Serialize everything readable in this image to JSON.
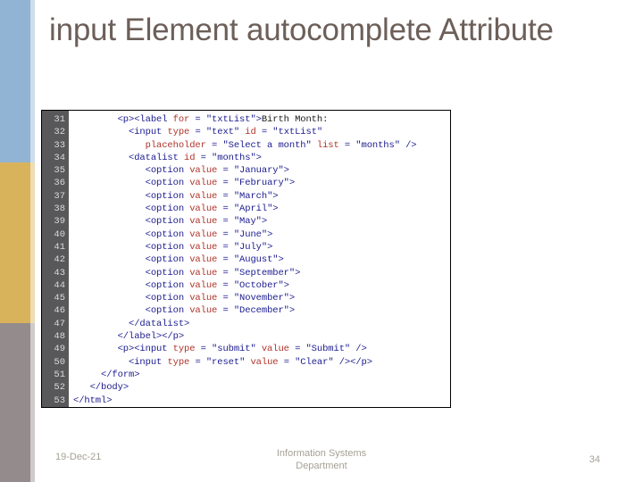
{
  "slide": {
    "title": "input Element autocomplete Attribute",
    "background_color": "#ffffff",
    "title_color": "#6d5f59"
  },
  "sidebar": {
    "bands": [
      {
        "name": "blue-band",
        "color": "#92b4d4"
      },
      {
        "name": "gold-band",
        "color": "#d9b35c"
      },
      {
        "name": "gray-band",
        "color": "#948c8c"
      }
    ]
  },
  "code_block": {
    "gutter_color": "#58585a",
    "line_number_color": "#d9d9d9",
    "border_color": "#000000",
    "tag_color": "#1b1b90",
    "attr_color": "#b0342a",
    "string_color": "#1b1b90",
    "first_line_number": 31,
    "line_numbers": [
      31,
      32,
      33,
      34,
      35,
      36,
      37,
      38,
      39,
      40,
      41,
      42,
      43,
      44,
      45,
      46,
      47,
      48,
      49,
      50,
      51,
      52,
      53
    ],
    "lines": [
      {
        "n": 31,
        "indent": 8,
        "tokens": [
          {
            "t": "tag",
            "v": "<p><label "
          },
          {
            "t": "attr",
            "v": "for"
          },
          {
            "t": "tag",
            "v": " = "
          },
          {
            "t": "str",
            "v": "\"txtList\""
          },
          {
            "t": "tag",
            "v": ">"
          },
          {
            "t": "txt",
            "v": "Birth Month:"
          }
        ]
      },
      {
        "n": 32,
        "indent": 10,
        "tokens": [
          {
            "t": "tag",
            "v": "<input "
          },
          {
            "t": "attr",
            "v": "type"
          },
          {
            "t": "tag",
            "v": " = "
          },
          {
            "t": "str",
            "v": "\"text\""
          },
          {
            "t": "tag",
            "v": " "
          },
          {
            "t": "attr",
            "v": "id"
          },
          {
            "t": "tag",
            "v": " = "
          },
          {
            "t": "str",
            "v": "\"txtList\""
          }
        ]
      },
      {
        "n": 33,
        "indent": 13,
        "tokens": [
          {
            "t": "attr",
            "v": "placeholder"
          },
          {
            "t": "tag",
            "v": " = "
          },
          {
            "t": "str",
            "v": "\"Select a month\""
          },
          {
            "t": "tag",
            "v": " "
          },
          {
            "t": "attr",
            "v": "list"
          },
          {
            "t": "tag",
            "v": " = "
          },
          {
            "t": "str",
            "v": "\"months\""
          },
          {
            "t": "tag",
            "v": " />"
          }
        ]
      },
      {
        "n": 34,
        "indent": 10,
        "tokens": [
          {
            "t": "tag",
            "v": "<datalist "
          },
          {
            "t": "attr",
            "v": "id"
          },
          {
            "t": "tag",
            "v": " = "
          },
          {
            "t": "str",
            "v": "\"months\""
          },
          {
            "t": "tag",
            "v": ">"
          }
        ]
      },
      {
        "n": 35,
        "indent": 13,
        "tokens": [
          {
            "t": "tag",
            "v": "<option "
          },
          {
            "t": "attr",
            "v": "value"
          },
          {
            "t": "tag",
            "v": " = "
          },
          {
            "t": "str",
            "v": "\"January\""
          },
          {
            "t": "tag",
            "v": ">"
          }
        ]
      },
      {
        "n": 36,
        "indent": 13,
        "tokens": [
          {
            "t": "tag",
            "v": "<option "
          },
          {
            "t": "attr",
            "v": "value"
          },
          {
            "t": "tag",
            "v": " = "
          },
          {
            "t": "str",
            "v": "\"February\""
          },
          {
            "t": "tag",
            "v": ">"
          }
        ]
      },
      {
        "n": 37,
        "indent": 13,
        "tokens": [
          {
            "t": "tag",
            "v": "<option "
          },
          {
            "t": "attr",
            "v": "value"
          },
          {
            "t": "tag",
            "v": " = "
          },
          {
            "t": "str",
            "v": "\"March\""
          },
          {
            "t": "tag",
            "v": ">"
          }
        ]
      },
      {
        "n": 38,
        "indent": 13,
        "tokens": [
          {
            "t": "tag",
            "v": "<option "
          },
          {
            "t": "attr",
            "v": "value"
          },
          {
            "t": "tag",
            "v": " = "
          },
          {
            "t": "str",
            "v": "\"April\""
          },
          {
            "t": "tag",
            "v": ">"
          }
        ]
      },
      {
        "n": 39,
        "indent": 13,
        "tokens": [
          {
            "t": "tag",
            "v": "<option "
          },
          {
            "t": "attr",
            "v": "value"
          },
          {
            "t": "tag",
            "v": " = "
          },
          {
            "t": "str",
            "v": "\"May\""
          },
          {
            "t": "tag",
            "v": ">"
          }
        ]
      },
      {
        "n": 40,
        "indent": 13,
        "tokens": [
          {
            "t": "tag",
            "v": "<option "
          },
          {
            "t": "attr",
            "v": "value"
          },
          {
            "t": "tag",
            "v": " = "
          },
          {
            "t": "str",
            "v": "\"June\""
          },
          {
            "t": "tag",
            "v": ">"
          }
        ]
      },
      {
        "n": 41,
        "indent": 13,
        "tokens": [
          {
            "t": "tag",
            "v": "<option "
          },
          {
            "t": "attr",
            "v": "value"
          },
          {
            "t": "tag",
            "v": " = "
          },
          {
            "t": "str",
            "v": "\"July\""
          },
          {
            "t": "tag",
            "v": ">"
          }
        ]
      },
      {
        "n": 42,
        "indent": 13,
        "tokens": [
          {
            "t": "tag",
            "v": "<option "
          },
          {
            "t": "attr",
            "v": "value"
          },
          {
            "t": "tag",
            "v": " = "
          },
          {
            "t": "str",
            "v": "\"August\""
          },
          {
            "t": "tag",
            "v": ">"
          }
        ]
      },
      {
        "n": 43,
        "indent": 13,
        "tokens": [
          {
            "t": "tag",
            "v": "<option "
          },
          {
            "t": "attr",
            "v": "value"
          },
          {
            "t": "tag",
            "v": " = "
          },
          {
            "t": "str",
            "v": "\"September\""
          },
          {
            "t": "tag",
            "v": ">"
          }
        ]
      },
      {
        "n": 44,
        "indent": 13,
        "tokens": [
          {
            "t": "tag",
            "v": "<option "
          },
          {
            "t": "attr",
            "v": "value"
          },
          {
            "t": "tag",
            "v": " = "
          },
          {
            "t": "str",
            "v": "\"October\""
          },
          {
            "t": "tag",
            "v": ">"
          }
        ]
      },
      {
        "n": 45,
        "indent": 13,
        "tokens": [
          {
            "t": "tag",
            "v": "<option "
          },
          {
            "t": "attr",
            "v": "value"
          },
          {
            "t": "tag",
            "v": " = "
          },
          {
            "t": "str",
            "v": "\"November\""
          },
          {
            "t": "tag",
            "v": ">"
          }
        ]
      },
      {
        "n": 46,
        "indent": 13,
        "tokens": [
          {
            "t": "tag",
            "v": "<option "
          },
          {
            "t": "attr",
            "v": "value"
          },
          {
            "t": "tag",
            "v": " = "
          },
          {
            "t": "str",
            "v": "\"December\""
          },
          {
            "t": "tag",
            "v": ">"
          }
        ]
      },
      {
        "n": 47,
        "indent": 10,
        "tokens": [
          {
            "t": "tag",
            "v": "</datalist>"
          }
        ]
      },
      {
        "n": 48,
        "indent": 8,
        "tokens": [
          {
            "t": "tag",
            "v": "</label></p>"
          }
        ]
      },
      {
        "n": 49,
        "indent": 8,
        "tokens": [
          {
            "t": "tag",
            "v": "<p><input "
          },
          {
            "t": "attr",
            "v": "type"
          },
          {
            "t": "tag",
            "v": " = "
          },
          {
            "t": "str",
            "v": "\"submit\""
          },
          {
            "t": "tag",
            "v": " "
          },
          {
            "t": "attr",
            "v": "value"
          },
          {
            "t": "tag",
            "v": " = "
          },
          {
            "t": "str",
            "v": "\"Submit\""
          },
          {
            "t": "tag",
            "v": " />"
          }
        ]
      },
      {
        "n": 50,
        "indent": 10,
        "tokens": [
          {
            "t": "tag",
            "v": "<input "
          },
          {
            "t": "attr",
            "v": "type"
          },
          {
            "t": "tag",
            "v": " = "
          },
          {
            "t": "str",
            "v": "\"reset\""
          },
          {
            "t": "tag",
            "v": " "
          },
          {
            "t": "attr",
            "v": "value"
          },
          {
            "t": "tag",
            "v": " = "
          },
          {
            "t": "str",
            "v": "\"Clear\""
          },
          {
            "t": "tag",
            "v": " /></p>"
          }
        ]
      },
      {
        "n": 51,
        "indent": 5,
        "tokens": [
          {
            "t": "tag",
            "v": "</form>"
          }
        ]
      },
      {
        "n": 52,
        "indent": 3,
        "tokens": [
          {
            "t": "tag",
            "v": "</body>"
          }
        ]
      },
      {
        "n": 53,
        "indent": 0,
        "tokens": [
          {
            "t": "tag",
            "v": "</html>"
          }
        ]
      }
    ]
  },
  "footer": {
    "date": "19-Dec-21",
    "center": "Information Systems\nDepartment",
    "page_number": "34",
    "text_color": "#a5a195"
  }
}
